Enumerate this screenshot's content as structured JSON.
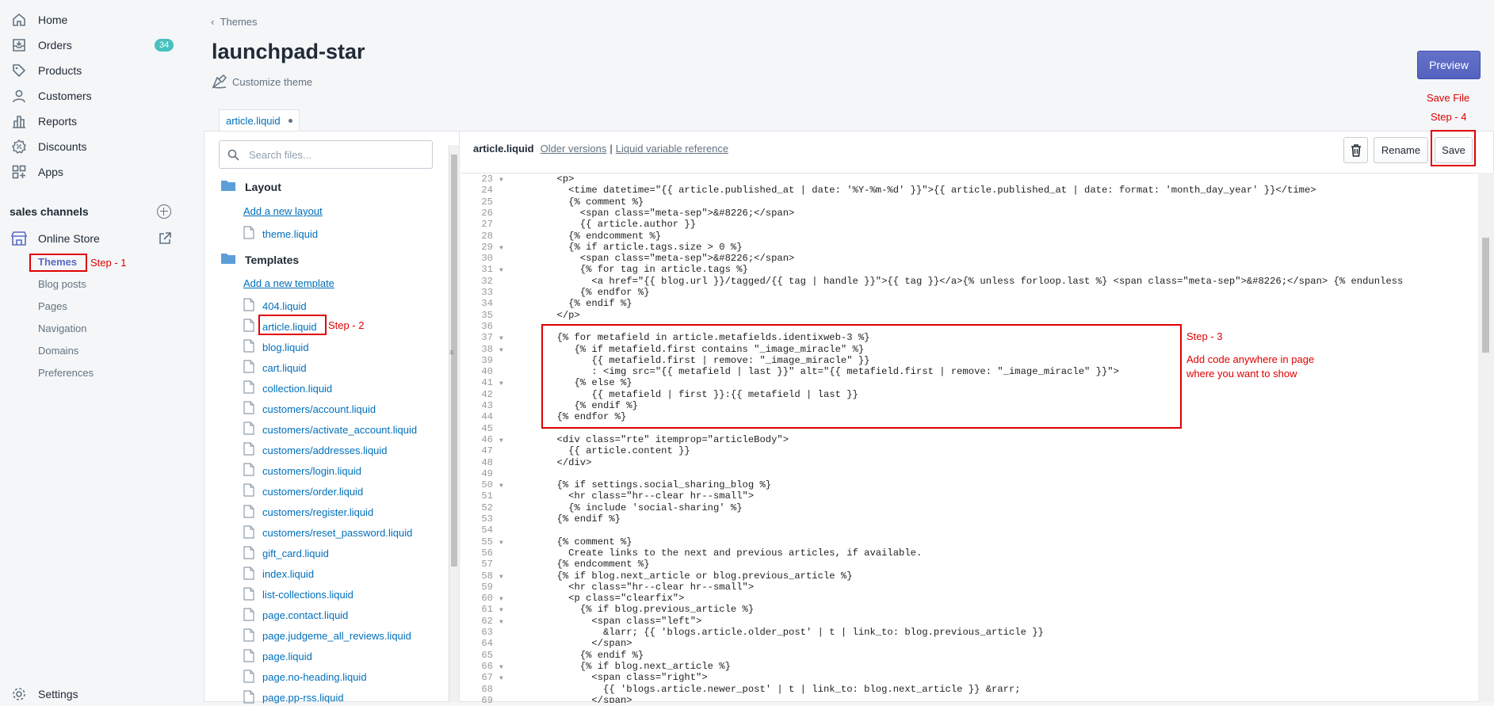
{
  "nav": {
    "items": [
      {
        "label": "Home",
        "icon": "home-icon"
      },
      {
        "label": "Orders",
        "icon": "orders-icon",
        "badge": "34"
      },
      {
        "label": "Products",
        "icon": "tag-icon"
      },
      {
        "label": "Customers",
        "icon": "person-icon"
      },
      {
        "label": "Reports",
        "icon": "bar-chart-icon"
      },
      {
        "label": "Discounts",
        "icon": "discount-icon"
      },
      {
        "label": "Apps",
        "icon": "apps-icon"
      }
    ],
    "sales_channels_label": "sales channels",
    "online_store_label": "Online Store",
    "sub_items": [
      "Themes",
      "Blog posts",
      "Pages",
      "Navigation",
      "Domains",
      "Preferences"
    ],
    "settings_label": "Settings"
  },
  "header": {
    "breadcrumb": "Themes",
    "theme_name": "launchpad-star",
    "customize_label": "Customize theme",
    "preview_label": "Preview",
    "tab_label": "article.liquid"
  },
  "files": {
    "search_placeholder": "Search files...",
    "layout_heading": "Layout",
    "add_layout": "Add a new layout",
    "layout_files": [
      "theme.liquid"
    ],
    "templates_heading": "Templates",
    "add_template": "Add a new template",
    "template_files": [
      "404.liquid",
      "article.liquid",
      "blog.liquid",
      "cart.liquid",
      "collection.liquid",
      "customers/account.liquid",
      "customers/activate_account.liquid",
      "customers/addresses.liquid",
      "customers/login.liquid",
      "customers/order.liquid",
      "customers/register.liquid",
      "customers/reset_password.liquid",
      "gift_card.liquid",
      "index.liquid",
      "list-collections.liquid",
      "page.contact.liquid",
      "page.judgeme_all_reviews.liquid",
      "page.liquid",
      "page.no-heading.liquid",
      "page.pp-rss.liquid"
    ]
  },
  "editor": {
    "filename": "article.liquid",
    "older_versions": "Older versions",
    "separator": "|",
    "variable_reference": "Liquid variable reference",
    "rename_label": "Rename",
    "save_label": "Save",
    "code_lines": [
      {
        "n": "23",
        "t": "        <p>"
      },
      {
        "n": "24",
        "t": "          <time datetime=\"{{ article.published_at | date: '%Y-%m-%d' }}\">{{ article.published_at | date: format: 'month_day_year' }}</time>"
      },
      {
        "n": "25",
        "t": "          {% comment %}"
      },
      {
        "n": "26",
        "t": "            <span class=\"meta-sep\">&#8226;</span>"
      },
      {
        "n": "27",
        "t": "            {{ article.author }}"
      },
      {
        "n": "28",
        "t": "          {% endcomment %}"
      },
      {
        "n": "29",
        "t": "          {% if article.tags.size > 0 %}"
      },
      {
        "n": "30",
        "t": "            <span class=\"meta-sep\">&#8226;</span>"
      },
      {
        "n": "31",
        "t": "            {% for tag in article.tags %}"
      },
      {
        "n": "32",
        "t": "              <a href=\"{{ blog.url }}/tagged/{{ tag | handle }}\">{{ tag }}</a>{% unless forloop.last %} <span class=\"meta-sep\">&#8226;</span> {% endunless"
      },
      {
        "n": "33",
        "t": "            {% endfor %}"
      },
      {
        "n": "34",
        "t": "          {% endif %}"
      },
      {
        "n": "35",
        "t": "        </p>"
      },
      {
        "n": "36",
        "t": ""
      },
      {
        "n": "37",
        "t": "        {% for metafield in article.metafields.identixweb-3 %}"
      },
      {
        "n": "38",
        "t": "           {% if metafield.first contains \"_image_miracle\" %}"
      },
      {
        "n": "39",
        "t": "              {{ metafield.first | remove: \"_image_miracle\" }}"
      },
      {
        "n": "40",
        "t": "              : <img src=\"{{ metafield | last }}\" alt=\"{{ metafield.first | remove: \"_image_miracle\" }}\">"
      },
      {
        "n": "41",
        "t": "           {% else %}"
      },
      {
        "n": "42",
        "t": "              {{ metafield | first }}:{{ metafield | last }}"
      },
      {
        "n": "43",
        "t": "           {% endif %}"
      },
      {
        "n": "44",
        "t": "        {% endfor %}"
      },
      {
        "n": "45",
        "t": ""
      },
      {
        "n": "46",
        "t": "        <div class=\"rte\" itemprop=\"articleBody\">"
      },
      {
        "n": "47",
        "t": "          {{ article.content }}"
      },
      {
        "n": "48",
        "t": "        </div>"
      },
      {
        "n": "49",
        "t": ""
      },
      {
        "n": "50",
        "t": "        {% if settings.social_sharing_blog %}"
      },
      {
        "n": "51",
        "t": "          <hr class=\"hr--clear hr--small\">"
      },
      {
        "n": "52",
        "t": "          {% include 'social-sharing' %}"
      },
      {
        "n": "53",
        "t": "        {% endif %}"
      },
      {
        "n": "54",
        "t": ""
      },
      {
        "n": "55",
        "t": "        {% comment %}"
      },
      {
        "n": "56",
        "t": "          Create links to the next and previous articles, if available."
      },
      {
        "n": "57",
        "t": "        {% endcomment %}"
      },
      {
        "n": "58",
        "t": "        {% if blog.next_article or blog.previous_article %}"
      },
      {
        "n": "59",
        "t": "          <hr class=\"hr--clear hr--small\">"
      },
      {
        "n": "60",
        "t": "          <p class=\"clearfix\">"
      },
      {
        "n": "61",
        "t": "            {% if blog.previous_article %}"
      },
      {
        "n": "62",
        "t": "              <span class=\"left\">"
      },
      {
        "n": "63",
        "t": "                &larr; {{ 'blogs.article.older_post' | t | link_to: blog.previous_article }}"
      },
      {
        "n": "64",
        "t": "              </span>"
      },
      {
        "n": "65",
        "t": "            {% endif %}"
      },
      {
        "n": "66",
        "t": "            {% if blog.next_article %}"
      },
      {
        "n": "67",
        "t": "              <span class=\"right\">"
      },
      {
        "n": "68",
        "t": "                {{ 'blogs.article.newer_post' | t | link_to: blog.next_article }} &rarr;"
      },
      {
        "n": "69",
        "t": "              </span>"
      }
    ]
  },
  "annotations": {
    "step1": "Step - 1",
    "step2": "Step - 2",
    "step3": "Step - 3",
    "step3_note_line1": "Add code anywhere in page",
    "step3_note_line2": "where you want to show",
    "save_file": "Save File",
    "step4": "Step - 4"
  },
  "colors": {
    "accent": "#5c6ac4",
    "link": "#006fbb",
    "annotation": "#e00000",
    "badge": "#47c1bf"
  }
}
